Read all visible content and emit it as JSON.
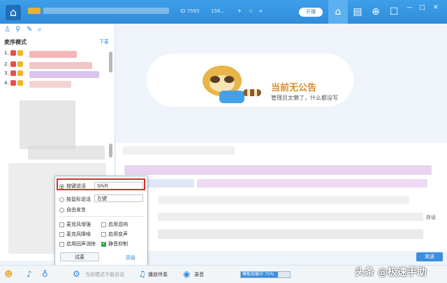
{
  "titlebar": {
    "room_id": "ID 7593",
    "online": "158...",
    "live_button": "开播",
    "window_buttons": [
      "—",
      "□",
      "✕"
    ]
  },
  "sidebar": {
    "mic_mode_label": "麦序模式",
    "down_label": "下麦",
    "queue_numbers": [
      "1.",
      "2.",
      "3.",
      "4."
    ]
  },
  "notice": {
    "title": "当前无公告",
    "subtitle": "管理员太懒了，什么都没写"
  },
  "voice_popup": {
    "push_to_talk_label": "按键说话",
    "push_to_talk_key": "Shift",
    "mouse_talk_label": "按鼠标说话",
    "mouse_talk_key": "左键",
    "free_talk_label": "自由发言",
    "options": [
      {
        "label": "麦克风增强",
        "checked": false
      },
      {
        "label": "启用混响",
        "checked": false
      },
      {
        "label": "麦克风降噪",
        "checked": false
      },
      {
        "label": "启用变声",
        "checked": false
      },
      {
        "label": "启用回声消除",
        "checked": false
      },
      {
        "label": "静音抑制",
        "checked": true
      }
    ],
    "test_button": "试麦",
    "advanced_link": "高级"
  },
  "bottombar": {
    "cannot_speak": "当前模式不能说话",
    "accompany": "播放伴奏",
    "record": "录音",
    "progress_label": "模板加载中 75%",
    "progress": 0.75
  },
  "chat": {
    "side_label": "存设",
    "send_button": "发送"
  },
  "watermark": "头条 @极速手助",
  "colors": {
    "accent": "#2f8ddc",
    "highlight": "#e02a2a",
    "checked": "#2fa84f"
  }
}
